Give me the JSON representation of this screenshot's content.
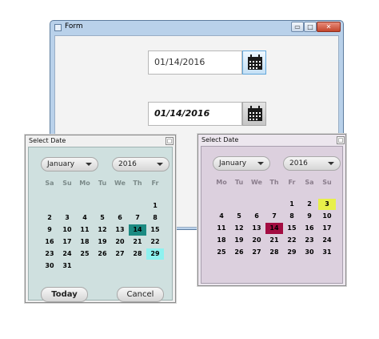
{
  "form": {
    "title": "Form",
    "window_buttons": {
      "minimize": "▭",
      "maximize": "□",
      "close": "✕"
    },
    "field1": {
      "value": "01/14/2016"
    },
    "field2": {
      "value": "01/14/2016"
    },
    "calendar_button_icon": "calendar-icon"
  },
  "popup_left": {
    "title": "Select Date",
    "close_glyph": "□",
    "month": "January",
    "year": "2016",
    "weekdays": [
      "Sa",
      "Su",
      "Mo",
      "Tu",
      "We",
      "Th",
      "Fr"
    ],
    "days": [
      [
        "",
        "",
        "",
        "",
        "",
        "",
        "1"
      ],
      [
        "2",
        "3",
        "4",
        "5",
        "6",
        "7",
        "8"
      ],
      [
        "9",
        "10",
        "11",
        "12",
        "13",
        "14",
        "15"
      ],
      [
        "16",
        "17",
        "18",
        "19",
        "20",
        "21",
        "22"
      ],
      [
        "23",
        "24",
        "25",
        "26",
        "27",
        "28",
        "29"
      ],
      [
        "30",
        "31",
        "",
        "",
        "",
        "",
        ""
      ]
    ],
    "selected_day": "14",
    "highlighted_day": "29",
    "today_label": "Today",
    "cancel_label": "Cancel",
    "colors": {
      "selected": "#1c8a82",
      "highlight": "#8ef1ef",
      "background": "#cfe0df"
    }
  },
  "popup_right": {
    "title": "Select Date",
    "close_glyph": "□",
    "month": "January",
    "year": "2016",
    "weekdays": [
      "Mo",
      "Tu",
      "We",
      "Th",
      "Fr",
      "Sa",
      "Su"
    ],
    "days": [
      [
        "",
        "",
        "",
        "",
        "1",
        "2",
        "3"
      ],
      [
        "4",
        "5",
        "6",
        "7",
        "8",
        "9",
        "10"
      ],
      [
        "11",
        "12",
        "13",
        "14",
        "15",
        "16",
        "17"
      ],
      [
        "18",
        "19",
        "20",
        "21",
        "22",
        "23",
        "24"
      ],
      [
        "25",
        "26",
        "27",
        "28",
        "29",
        "30",
        "31"
      ]
    ],
    "selected_day": "14",
    "highlighted_day": "3",
    "colors": {
      "selected": "#a30d42",
      "highlight": "#e8f04a",
      "background": "#dcd0de"
    }
  }
}
